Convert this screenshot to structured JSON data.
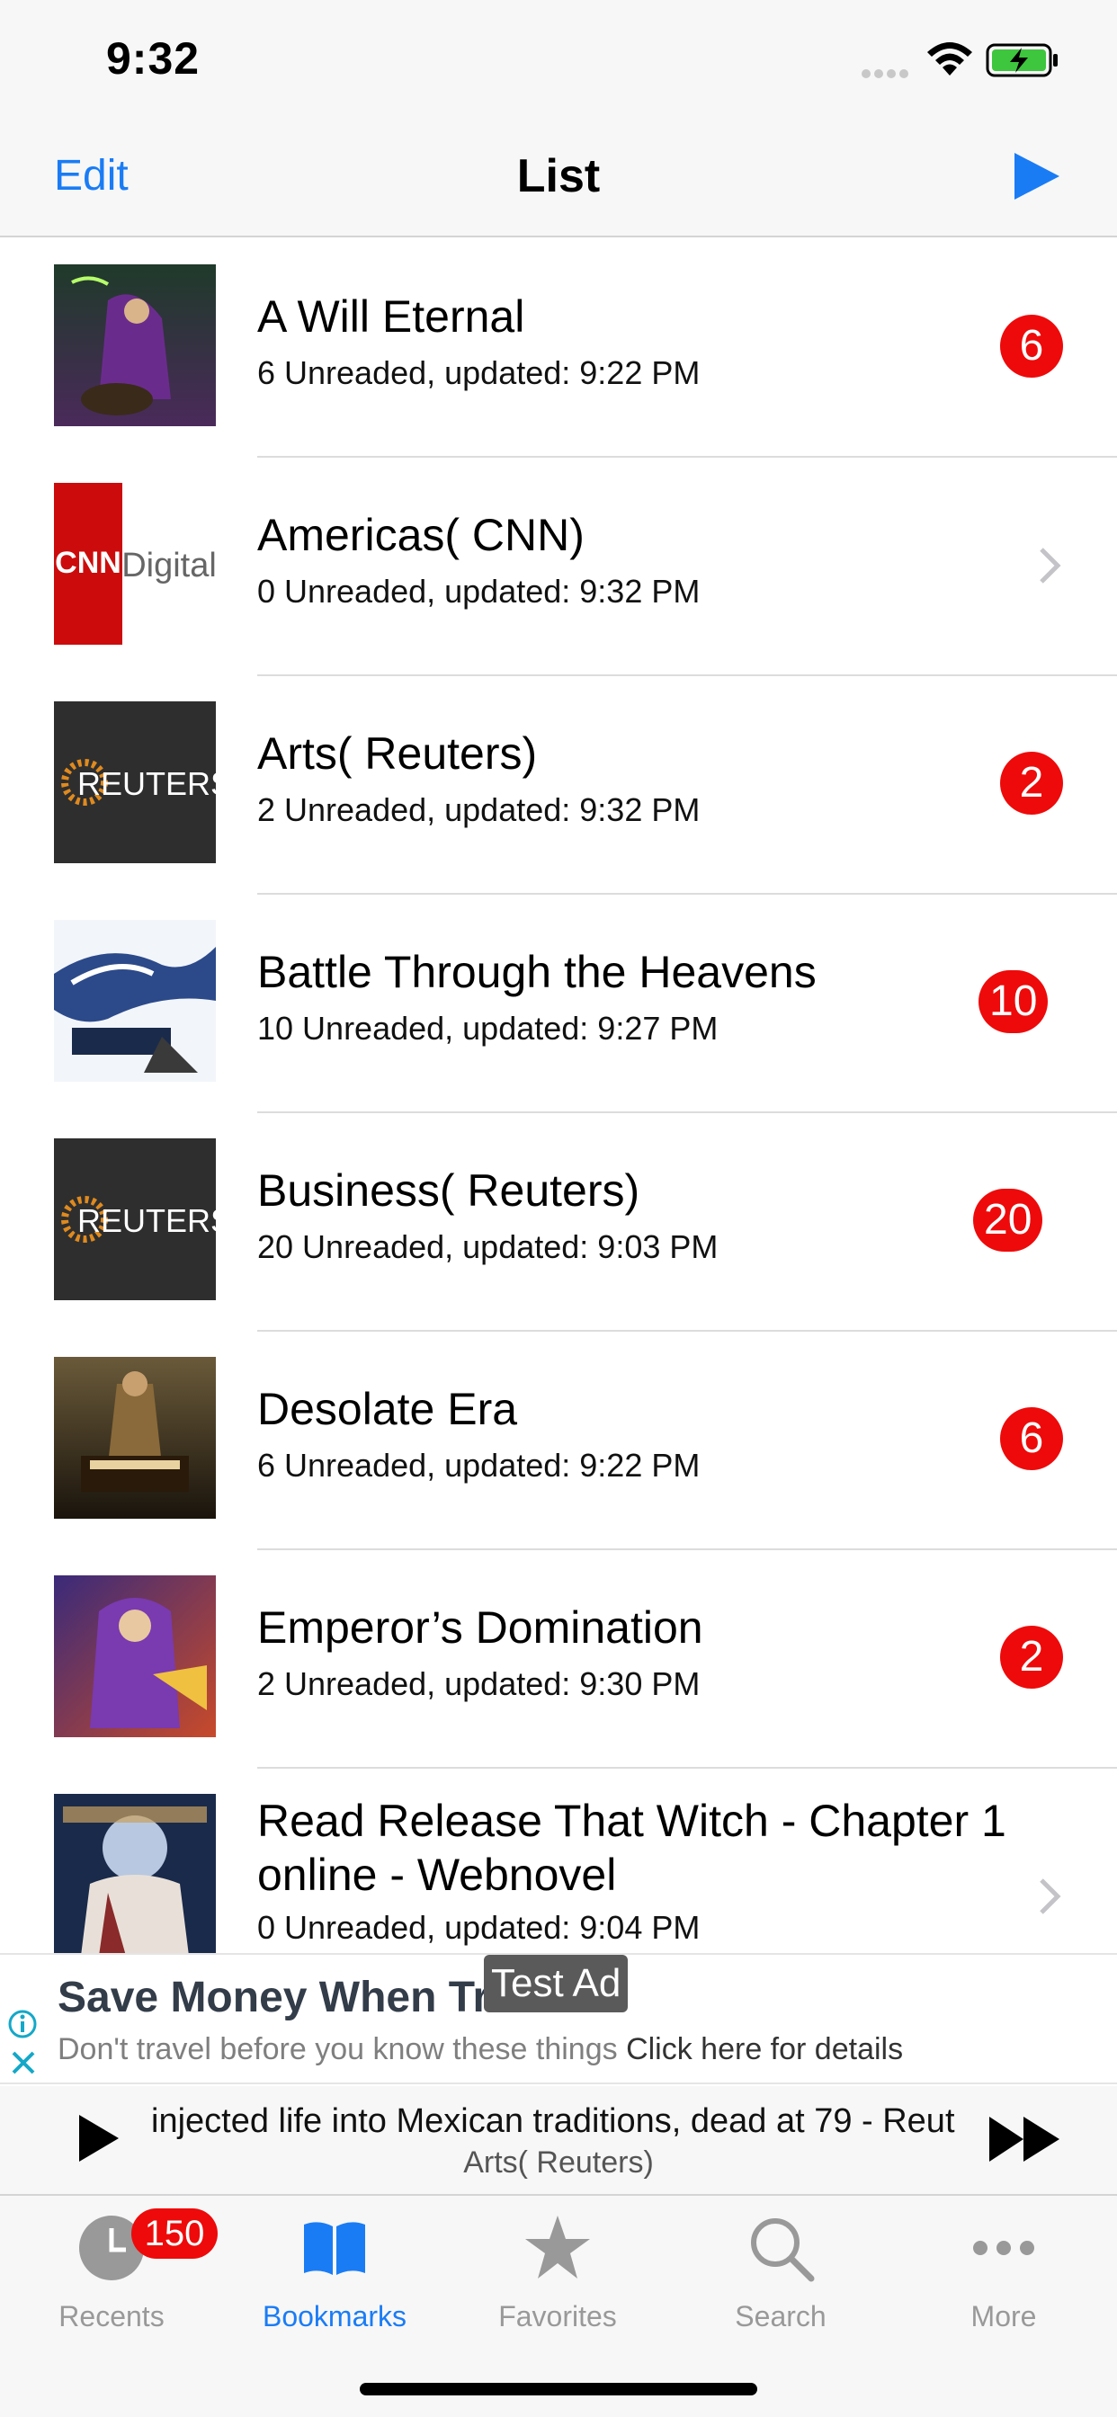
{
  "status_bar": {
    "time": "9:32"
  },
  "nav": {
    "edit_label": "Edit",
    "title": "List"
  },
  "colors": {
    "accent": "#1a7cf5",
    "badge": "#ee0a0a",
    "inactive": "#999999"
  },
  "rows": [
    {
      "title": "A Will Eternal",
      "subtitle": "6 Unreaded, updated: 9:22 PM",
      "badge": "6",
      "thumb": "novel-cover-a-will-eternal"
    },
    {
      "title": "Americas( CNN)",
      "subtitle": "0 Unreaded, updated: 9:32 PM",
      "badge": null,
      "thumb": "cnn-digital-logo"
    },
    {
      "title": "Arts( Reuters)",
      "subtitle": "2 Unreaded, updated: 9:32 PM",
      "badge": "2",
      "thumb": "reuters-logo"
    },
    {
      "title": "Battle Through the Heavens",
      "subtitle": "10 Unreaded, updated: 9:27 PM",
      "badge": "10",
      "thumb": "novel-cover-battle-through-the-heavens"
    },
    {
      "title": "Business( Reuters)",
      "subtitle": "20 Unreaded, updated: 9:03 PM",
      "badge": "20",
      "thumb": "reuters-logo"
    },
    {
      "title": "Desolate Era",
      "subtitle": "6 Unreaded, updated: 9:22 PM",
      "badge": "6",
      "thumb": "novel-cover-desolate-era"
    },
    {
      "title": "Emperor’s Domination",
      "subtitle": "2 Unreaded, updated: 9:30 PM",
      "badge": "2",
      "thumb": "novel-cover-emperors-domination"
    },
    {
      "title": "Read Release That Witch - Chapter 1 online - Webnovel",
      "subtitle": "0 Unreaded, updated: 9:04 PM",
      "badge": null,
      "thumb": "novel-cover-release-that-witch"
    }
  ],
  "thumb_text": {
    "cnn": "CNN",
    "digital": "Digital",
    "reuters": "REUTERS"
  },
  "ad": {
    "headline": "Save Money When Tra",
    "label": "Test Ad",
    "body": "Don't travel before you know these things ",
    "cta": "Click here for details"
  },
  "player": {
    "title": "injected life into Mexican traditions, dead at 79 - Reut",
    "subtitle": "Arts( Reuters)"
  },
  "tabs": [
    {
      "label": "Recents",
      "icon": "clock-icon",
      "badge": "150"
    },
    {
      "label": "Bookmarks",
      "icon": "book-icon",
      "active": true
    },
    {
      "label": "Favorites",
      "icon": "star-icon"
    },
    {
      "label": "Search",
      "icon": "search-icon"
    },
    {
      "label": "More",
      "icon": "more-icon"
    }
  ]
}
